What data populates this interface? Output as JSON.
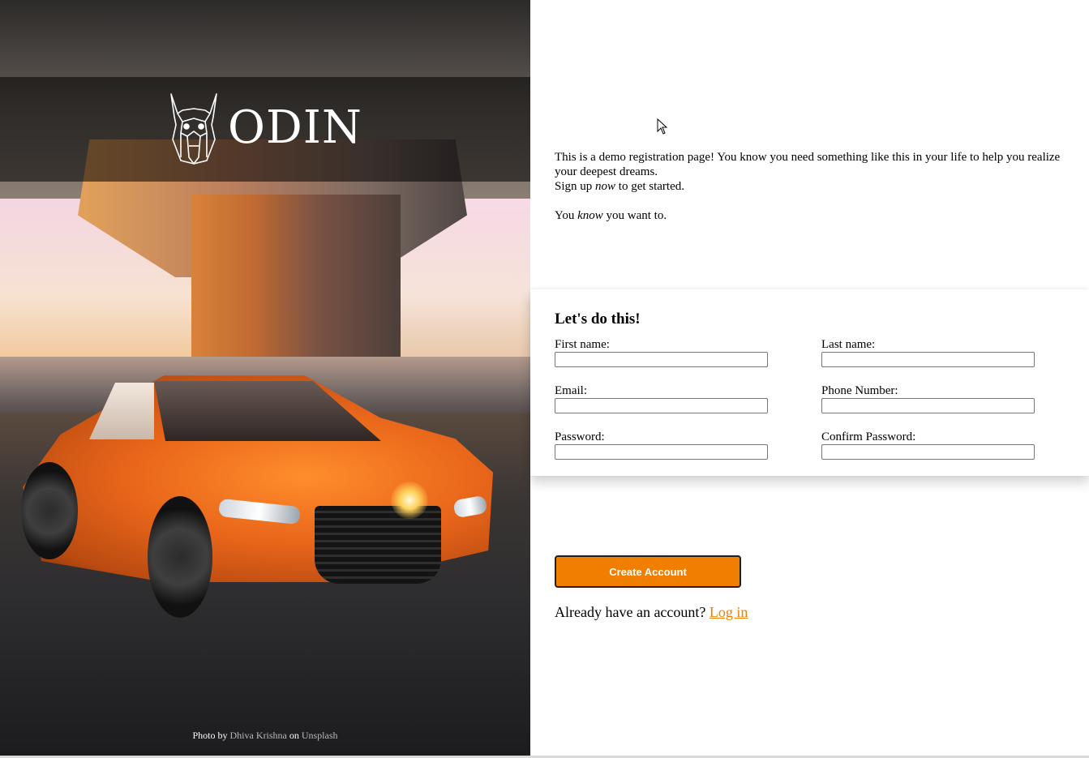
{
  "brand": {
    "name": "ODIN",
    "logo_icon": "viking-helmet-icon"
  },
  "photo_credit": {
    "prefix": "Photo by",
    "author": "Dhiva Krishna",
    "middle": "on",
    "source": "Unsplash"
  },
  "intro": {
    "line1": "This is a demo registration page! You know you need something like this in your life to help you realize your deepest dreams.",
    "line2_a": "Sign up ",
    "line2_em": "now",
    "line2_b": " to get started.",
    "line3_a": "You ",
    "line3_em": "know",
    "line3_b": " you want to."
  },
  "form": {
    "title": "Let's do this!",
    "fields": {
      "first_name": {
        "label": "First name:",
        "value": ""
      },
      "last_name": {
        "label": "Last name:",
        "value": ""
      },
      "email": {
        "label": "Email:",
        "value": ""
      },
      "phone": {
        "label": "Phone Number:",
        "value": ""
      },
      "password": {
        "label": "Password:",
        "value": ""
      },
      "confirm_password": {
        "label": "Confirm Password:",
        "value": ""
      }
    }
  },
  "actions": {
    "create_account_label": "Create Account",
    "login_prompt": "Already have an account?",
    "login_link": "Log in"
  },
  "colors": {
    "accent": "#f07f00",
    "logo_band": "#000000",
    "panel_bg": "#ffffff"
  }
}
